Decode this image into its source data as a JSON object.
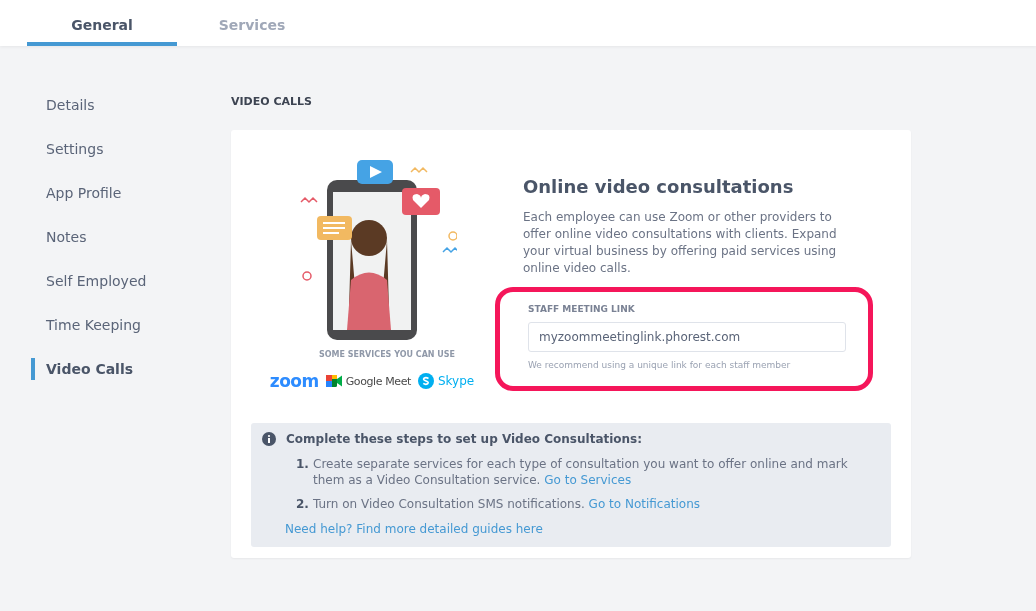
{
  "tabs": [
    {
      "label": "General",
      "selected": true
    },
    {
      "label": "Services",
      "selected": false
    }
  ],
  "sidebar": {
    "items": [
      {
        "label": "Details",
        "selected": false
      },
      {
        "label": "Settings",
        "selected": false
      },
      {
        "label": "App Profile",
        "selected": false
      },
      {
        "label": "Notes",
        "selected": false
      },
      {
        "label": "Self Employed",
        "selected": false
      },
      {
        "label": "Time Keeping",
        "selected": false
      },
      {
        "label": "Video Calls",
        "selected": true
      }
    ]
  },
  "section_title": "VIDEO CALLS",
  "card": {
    "services_caption": "SOME SERVICES YOU CAN USE",
    "services": [
      {
        "kind": "zoom",
        "label": "zoom"
      },
      {
        "kind": "meet",
        "label": "Google Meet"
      },
      {
        "kind": "skype",
        "label": "Skype"
      }
    ],
    "heading": "Online video consultations",
    "description": "Each employee can use Zoom or other providers to offer online video consultations with clients. Expand your virtual business by offering paid services using online video calls.",
    "field": {
      "label": "STAFF MEETING LINK",
      "value": "myzoommeetinglink.phorest.com",
      "hint": "We recommend using a unique link for each staff member",
      "highlighted": true
    },
    "steps_box": {
      "title": "Complete these steps to set up Video Consultations:",
      "steps": [
        {
          "number": "1.",
          "text": "Create separate services for each type of consultation you want to offer online and mark them as a Video Consultation service.",
          "link": "Go to Services"
        },
        {
          "number": "2.",
          "text": "Turn on Video Consultation SMS notifications.",
          "link": "Go to Notifications"
        }
      ],
      "help_link": "Need help? Find more detailed guides here"
    }
  }
}
